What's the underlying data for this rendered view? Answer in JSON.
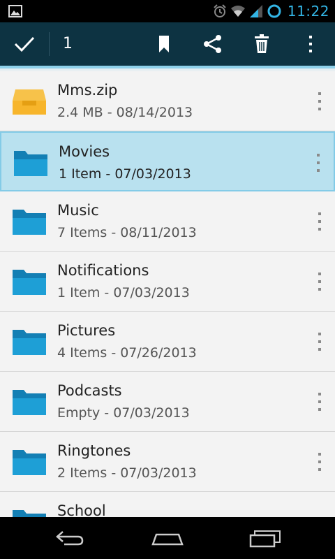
{
  "status_bar": {
    "time": "11:22",
    "icons": [
      "picture-icon",
      "alarm-icon",
      "wifi-icon",
      "signal-icon",
      "battery-icon"
    ]
  },
  "action_bar": {
    "selected_count": "1",
    "actions": [
      "done-check-icon",
      "bookmark-icon",
      "share-icon",
      "delete-icon",
      "overflow-menu-icon"
    ]
  },
  "files": [
    {
      "name": "Mms.zip",
      "meta": "2.4 MB - 08/14/2013",
      "type": "archive",
      "selected": false
    },
    {
      "name": "Movies",
      "meta": "1 Item - 07/03/2013",
      "type": "folder",
      "selected": true
    },
    {
      "name": "Music",
      "meta": "7 Items - 08/11/2013",
      "type": "folder",
      "selected": false
    },
    {
      "name": "Notifications",
      "meta": "1 Item - 07/03/2013",
      "type": "folder",
      "selected": false
    },
    {
      "name": "Pictures",
      "meta": "4 Items - 07/26/2013",
      "type": "folder",
      "selected": false
    },
    {
      "name": "Podcasts",
      "meta": "Empty - 07/03/2013",
      "type": "folder",
      "selected": false
    },
    {
      "name": "Ringtones",
      "meta": "2 Items - 07/03/2013",
      "type": "folder",
      "selected": false
    },
    {
      "name": "School",
      "meta": "",
      "type": "folder",
      "selected": false
    }
  ],
  "colors": {
    "accent": "#33b5e5",
    "action_bar": "#0d3342",
    "folder": "#1e9fd6",
    "archive": "#f7b52b",
    "selected_row": "#b9e1ef"
  },
  "nav_bar": {
    "buttons": [
      "back-icon",
      "home-icon",
      "recent-apps-icon"
    ]
  }
}
